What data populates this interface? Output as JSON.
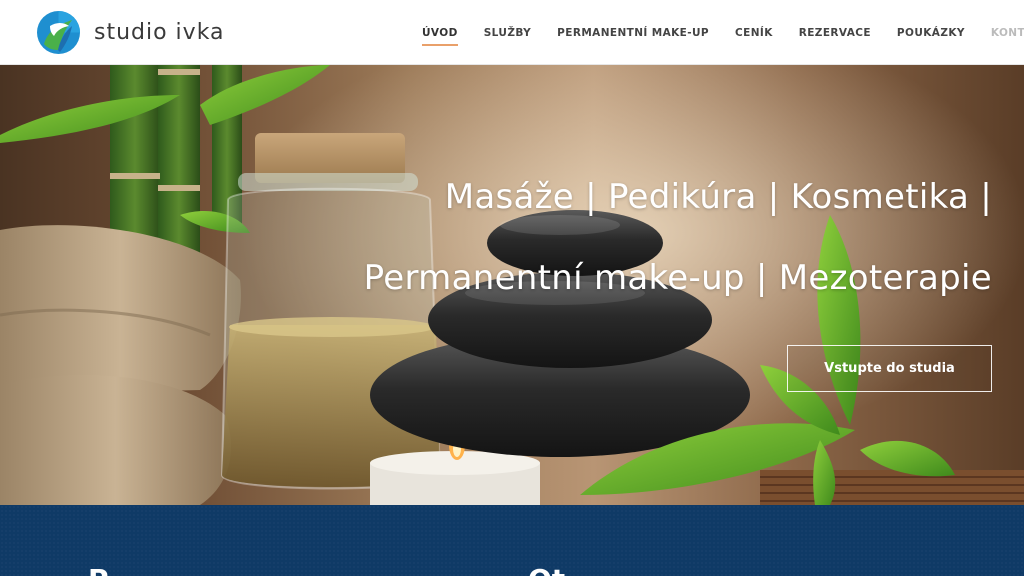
{
  "brand": {
    "name": "studio ivka",
    "logo_icon": "leaf-drop-logo-icon"
  },
  "nav": {
    "items": [
      {
        "label": "ÚVOD",
        "active": true
      },
      {
        "label": "SLUŽBY"
      },
      {
        "label": "PERMANENTNÍ MAKE-UP"
      },
      {
        "label": "CENÍK"
      },
      {
        "label": "REZERVACE"
      },
      {
        "label": "POUKÁZKY"
      },
      {
        "label": "KONTAKT"
      }
    ]
  },
  "hero": {
    "line1": "Masáže | Pedikúra | Kosmetika |",
    "line2": "Permanentní make-up | Mezoterapie",
    "cta_label": "Vstupte do studia"
  },
  "band": {
    "left_heading": "P",
    "right_heading": "Ot..."
  },
  "colors": {
    "accent": "#e9a06a",
    "band_blue": "#0f3a66",
    "logo_blue": "#1f8fd0",
    "logo_green": "#4ab04a"
  }
}
